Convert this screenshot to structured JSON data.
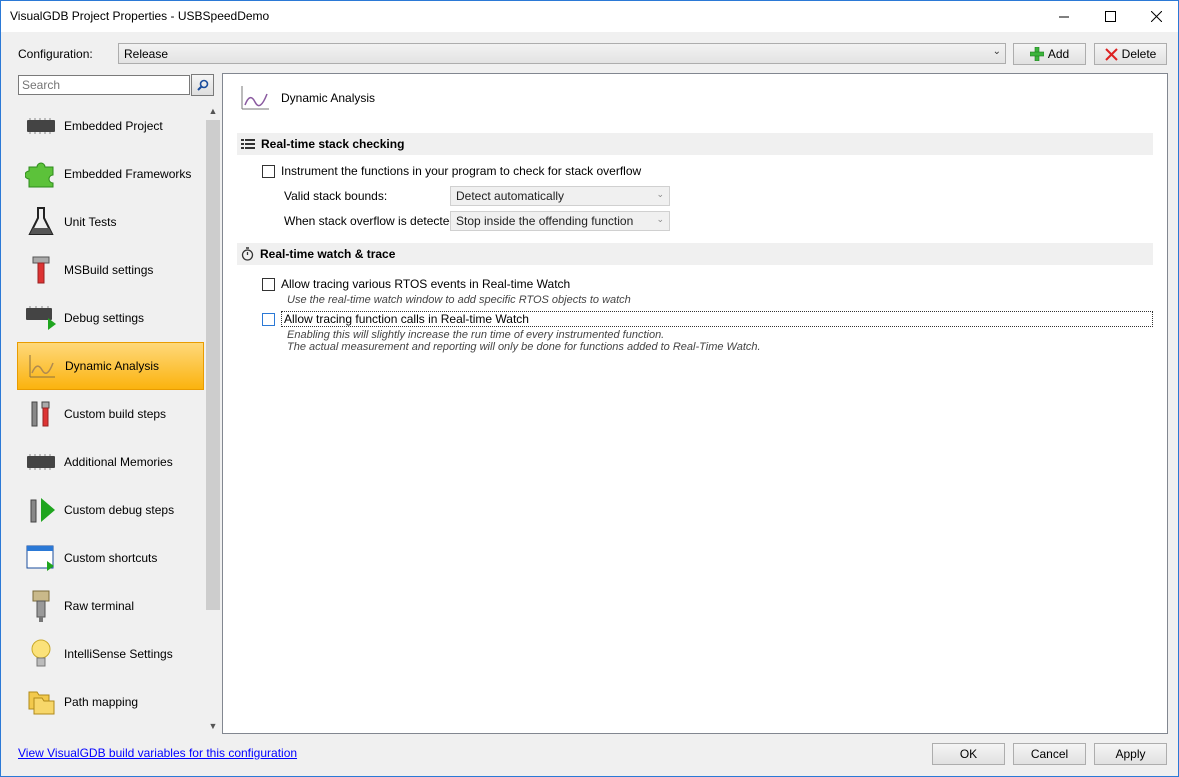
{
  "window": {
    "title": "VisualGDB Project Properties - USBSpeedDemo",
    "min_icon": "minimize-icon",
    "max_icon": "maximize-icon",
    "close_icon": "close-icon"
  },
  "config": {
    "label": "Configuration:",
    "selected": "Release",
    "add_label": "Add",
    "delete_label": "Delete"
  },
  "search": {
    "placeholder": "Search"
  },
  "sidebar": {
    "items": [
      {
        "label": "Embedded Project",
        "icon": "chip-icon"
      },
      {
        "label": "Embedded Frameworks",
        "icon": "puzzle-icon"
      },
      {
        "label": "Unit Tests",
        "icon": "flask-icon"
      },
      {
        "label": "MSBuild settings",
        "icon": "hammer-icon"
      },
      {
        "label": "Debug settings",
        "icon": "chip-play-icon"
      },
      {
        "label": "Dynamic Analysis",
        "icon": "chart-icon",
        "active": true
      },
      {
        "label": "Custom build steps",
        "icon": "tools-icon"
      },
      {
        "label": "Additional Memories",
        "icon": "chip-icon"
      },
      {
        "label": "Custom debug steps",
        "icon": "wrench-play-icon"
      },
      {
        "label": "Custom shortcuts",
        "icon": "window-icon"
      },
      {
        "label": "Raw terminal",
        "icon": "connector-icon"
      },
      {
        "label": "IntelliSense Settings",
        "icon": "lightbulb-icon"
      },
      {
        "label": "Path mapping",
        "icon": "folders-icon"
      }
    ]
  },
  "panel": {
    "title": "Dynamic Analysis",
    "stack": {
      "heading": "Real-time stack checking",
      "instrument_label": "Instrument the functions in your program to check for stack overflow",
      "bounds_label": "Valid stack bounds:",
      "bounds_value": "Detect automatically",
      "overflow_label": "When stack overflow is detected:",
      "overflow_value": "Stop inside the offending function"
    },
    "watch": {
      "heading": "Real-time watch & trace",
      "rtos_label": "Allow tracing various RTOS events in Real-time Watch",
      "rtos_hint": "Use the real-time watch window to add specific RTOS objects to watch",
      "calls_label": "Allow tracing function calls in Real-time Watch",
      "calls_hint1": "Enabling this will slightly increase the run time of every instrumented function.",
      "calls_hint2": "The actual measurement and reporting will only be done for functions added to Real-Time Watch."
    }
  },
  "footer": {
    "link": "View VisualGDB build variables for this configuration",
    "ok": "OK",
    "cancel": "Cancel",
    "apply": "Apply"
  },
  "colors": {
    "active_item_top": "#fed87a",
    "active_item_bottom": "#fbb30e",
    "link": "#0000ff",
    "accent_border": "#2b79d6"
  }
}
